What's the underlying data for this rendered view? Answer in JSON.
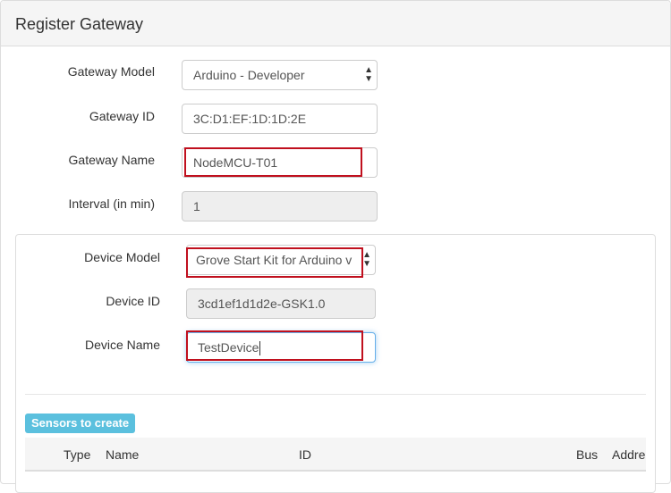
{
  "panel": {
    "title": "Register Gateway"
  },
  "gateway": {
    "model_label": "Gateway Model",
    "model_value": "Arduino - Developer",
    "id_label": "Gateway ID",
    "id_value": "3C:D1:EF:1D:1D:2E",
    "name_label": "Gateway Name",
    "name_value": "NodeMCU-T01",
    "interval_label": "Interval (in min)",
    "interval_value": "1"
  },
  "device": {
    "model_label": "Device Model",
    "model_value": "Grove Start Kit for Arduino v",
    "id_label": "Device ID",
    "id_value": "3cd1ef1d1d2e-GSK1.0",
    "name_label": "Device Name",
    "name_value": "TestDevice"
  },
  "sensors": {
    "badge": "Sensors to create",
    "columns": [
      "Type",
      "Name",
      "ID",
      "Bus",
      "Addre"
    ]
  },
  "colors": {
    "highlight": "#c0101e",
    "badge": "#5bc0de",
    "readonly_bg": "#eeeeee"
  },
  "icons": {
    "select_arrow": "updown-arrow-icon"
  }
}
